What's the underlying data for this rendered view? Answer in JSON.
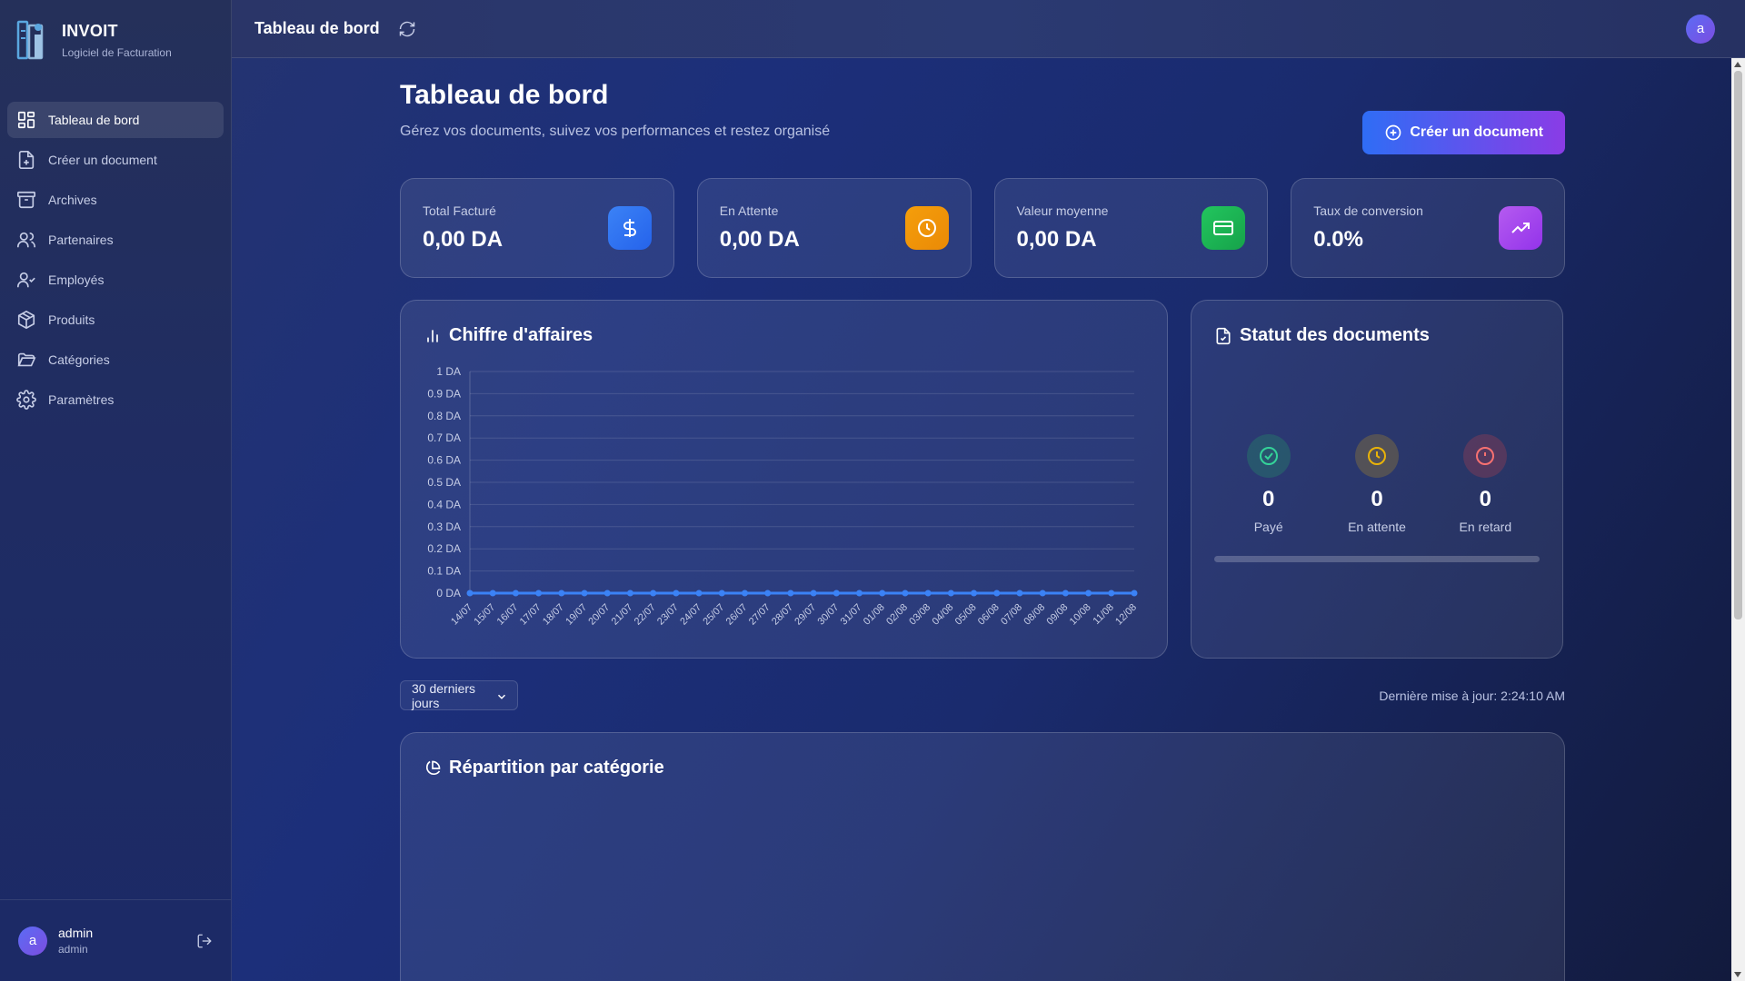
{
  "app": {
    "name": "INVOIT",
    "subtitle": "Logiciel de Facturation"
  },
  "sidebar": {
    "items": [
      {
        "label": "Tableau de bord",
        "icon": "dashboard-icon",
        "active": true
      },
      {
        "label": "Créer un document",
        "icon": "file-plus-icon",
        "active": false
      },
      {
        "label": "Archives",
        "icon": "archive-icon",
        "active": false
      },
      {
        "label": "Partenaires",
        "icon": "users-icon",
        "active": false
      },
      {
        "label": "Employés",
        "icon": "user-check-icon",
        "active": false
      },
      {
        "label": "Produits",
        "icon": "package-icon",
        "active": false
      },
      {
        "label": "Catégories",
        "icon": "folder-icon",
        "active": false
      },
      {
        "label": "Paramètres",
        "icon": "settings-icon",
        "active": false
      }
    ]
  },
  "user": {
    "initial": "a",
    "name": "admin",
    "role": "admin"
  },
  "header": {
    "title": "Tableau de bord"
  },
  "page": {
    "title": "Tableau de bord",
    "subtitle": "Gérez vos documents, suivez vos performances et restez organisé",
    "create_label": "Créer un document"
  },
  "stats": [
    {
      "label": "Total Facturé",
      "value": "0,00 DA",
      "icon": "dollar-icon",
      "color": "#2f6df5"
    },
    {
      "label": "En Attente",
      "value": "0,00 DA",
      "icon": "clock-icon",
      "color": "#f59e0b"
    },
    {
      "label": "Valeur moyenne",
      "value": "0,00 DA",
      "icon": "credit-card-icon",
      "color": "#16a34a"
    },
    {
      "label": "Taux de conversion",
      "value": "0.0%",
      "icon": "trending-up-icon",
      "color": "#a544e8"
    }
  ],
  "revenue": {
    "title": "Chiffre d'affaires"
  },
  "chart_data": {
    "type": "line",
    "title": "Chiffre d'affaires",
    "x": [
      "14/07",
      "15/07",
      "16/07",
      "17/07",
      "18/07",
      "19/07",
      "20/07",
      "21/07",
      "22/07",
      "23/07",
      "24/07",
      "25/07",
      "26/07",
      "27/07",
      "28/07",
      "29/07",
      "30/07",
      "31/07",
      "01/08",
      "02/08",
      "03/08",
      "04/08",
      "05/08",
      "06/08",
      "07/08",
      "08/08",
      "09/08",
      "10/08",
      "11/08",
      "12/08"
    ],
    "y_ticks": [
      "0 DA",
      "0.1 DA",
      "0.2 DA",
      "0.3 DA",
      "0.4 DA",
      "0.5 DA",
      "0.6 DA",
      "0.7 DA",
      "0.8 DA",
      "0.9 DA",
      "1 DA"
    ],
    "series": [
      {
        "values": [
          0,
          0,
          0,
          0,
          0,
          0,
          0,
          0,
          0,
          0,
          0,
          0,
          0,
          0,
          0,
          0,
          0,
          0,
          0,
          0,
          0,
          0,
          0,
          0,
          0,
          0,
          0,
          0,
          0,
          0
        ],
        "color": "#3b82f6"
      }
    ],
    "ylim": [
      0,
      1
    ],
    "grid": true
  },
  "status": {
    "title": "Statut des documents",
    "items": [
      {
        "count": "0",
        "label": "Payé",
        "icon": "check-circle-icon",
        "color": "#22c55e"
      },
      {
        "count": "0",
        "label": "En attente",
        "icon": "clock-icon",
        "color": "#eab308"
      },
      {
        "count": "0",
        "label": "En retard",
        "icon": "alert-circle-icon",
        "color": "#ef4444"
      }
    ],
    "paid_fraction": 0
  },
  "filter": {
    "period": "30 derniers jours",
    "last_update": "Dernière mise à jour: 2:24:10 AM"
  },
  "category": {
    "title": "Répartition par catégorie"
  }
}
